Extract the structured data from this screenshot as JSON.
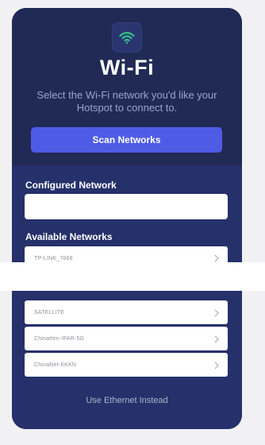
{
  "header": {
    "icon": "wifi-icon",
    "title": "Wi-Fi",
    "subtitle": "Select the Wi-Fi network you'd like your Hotspot to connect to."
  },
  "scan_button": {
    "label": "Scan Networks"
  },
  "configured": {
    "label": "Configured Network",
    "value": ""
  },
  "available": {
    "label": "Available Networks",
    "networks": [
      {
        "name": "TP-LINK_7668"
      },
      {
        "name": "SATELLITE"
      },
      {
        "name": "Chinatten-IPAR-5G"
      },
      {
        "name": "ChinaNet-KKKN"
      }
    ]
  },
  "footer": {
    "ethernet_link": "Use Ethernet Instead"
  },
  "colors": {
    "card_bg": "#212a55",
    "panel_bg": "#26306a",
    "accent": "#4e5ce5",
    "wifi_icon": "#35c28a"
  }
}
